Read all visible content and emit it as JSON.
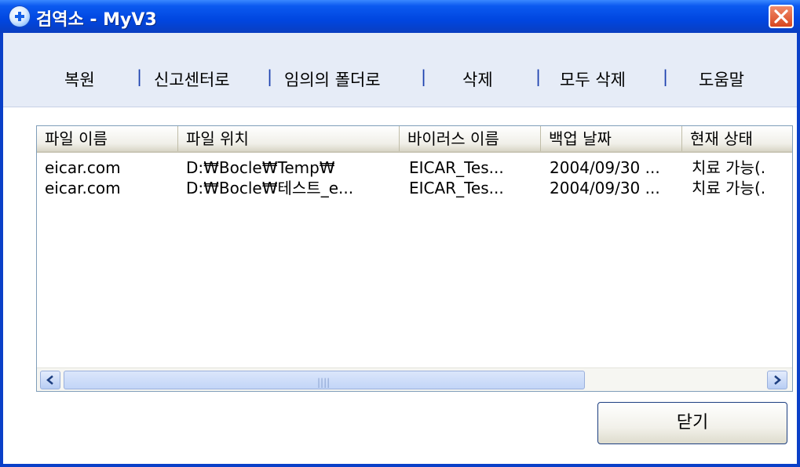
{
  "window": {
    "title": "검역소 - MyV3"
  },
  "toolbar": {
    "items": [
      "복원",
      "신고센터로",
      "임의의 폴더로",
      "삭제",
      "모두 삭제",
      "도움말"
    ],
    "separator": "|"
  },
  "table": {
    "columns": [
      "파일 이름",
      "파일 위치",
      "바이러스 이름",
      "백업 날짜",
      "현재 상태"
    ],
    "rows": [
      [
        "eicar.com",
        "D:₩Bocle₩Temp₩",
        "EICAR_Tes...",
        "2004/09/30 ...",
        "치료 가능(."
      ],
      [
        "eicar.com",
        "D:₩Bocle₩테스트_e...",
        "EICAR_Tes...",
        "2004/09/30 ...",
        "치료 가능(."
      ]
    ]
  },
  "buttons": {
    "close_label": "닫기"
  },
  "icons": {
    "app": "shield-plus-icon",
    "close": "close-x-icon",
    "scroll_left": "chevron-left-icon",
    "scroll_right": "chevron-right-icon"
  },
  "colors": {
    "titlebar": "#0046e0",
    "toolbar_bg": "#e6ecf7",
    "separator": "#1a3fae",
    "close_button": "#d8461e"
  }
}
